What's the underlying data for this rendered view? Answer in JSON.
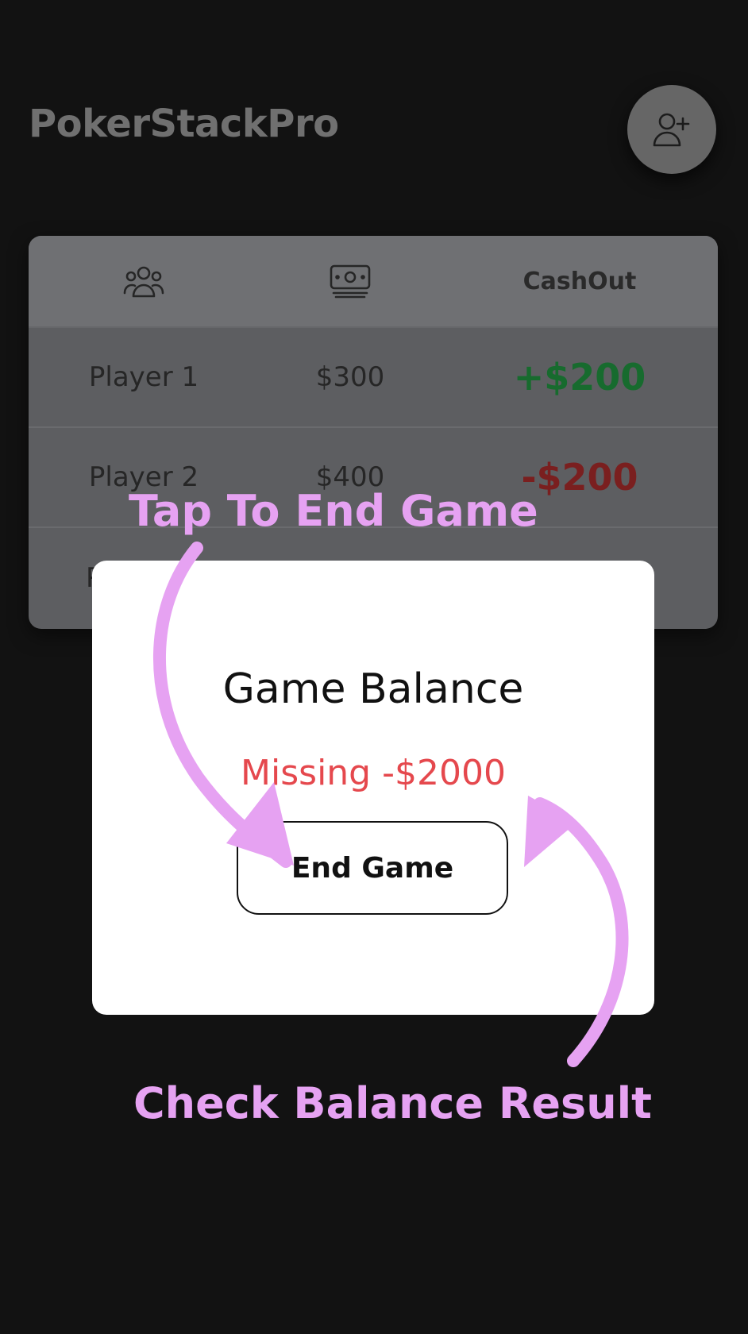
{
  "header": {
    "title": "PokerStackPro",
    "add_player_icon": "user-plus-icon"
  },
  "table": {
    "columns": [
      {
        "icon": "players-group-icon",
        "label": ""
      },
      {
        "icon": "cash-stack-icon",
        "label": ""
      },
      {
        "icon": "",
        "label": "CashOut"
      }
    ],
    "rows": [
      {
        "player": "Player 1",
        "buyin": "$300",
        "cashout": "+$200",
        "cashout_color": "#176b2e"
      },
      {
        "player": "Player 2",
        "buyin": "$400",
        "cashout": "-$200",
        "cashout_color": "#7a1f1f"
      },
      {
        "player": "P",
        "buyin": "",
        "cashout": ""
      }
    ]
  },
  "modal": {
    "title": "Game Balance",
    "status": "Missing -$2000",
    "status_color": "#e5484d",
    "end_button_label": "End Game"
  },
  "tutorial": {
    "top_caption": "Tap To End Game",
    "bottom_caption": "Check Balance Result",
    "caption_color": "#e6a2f2"
  }
}
